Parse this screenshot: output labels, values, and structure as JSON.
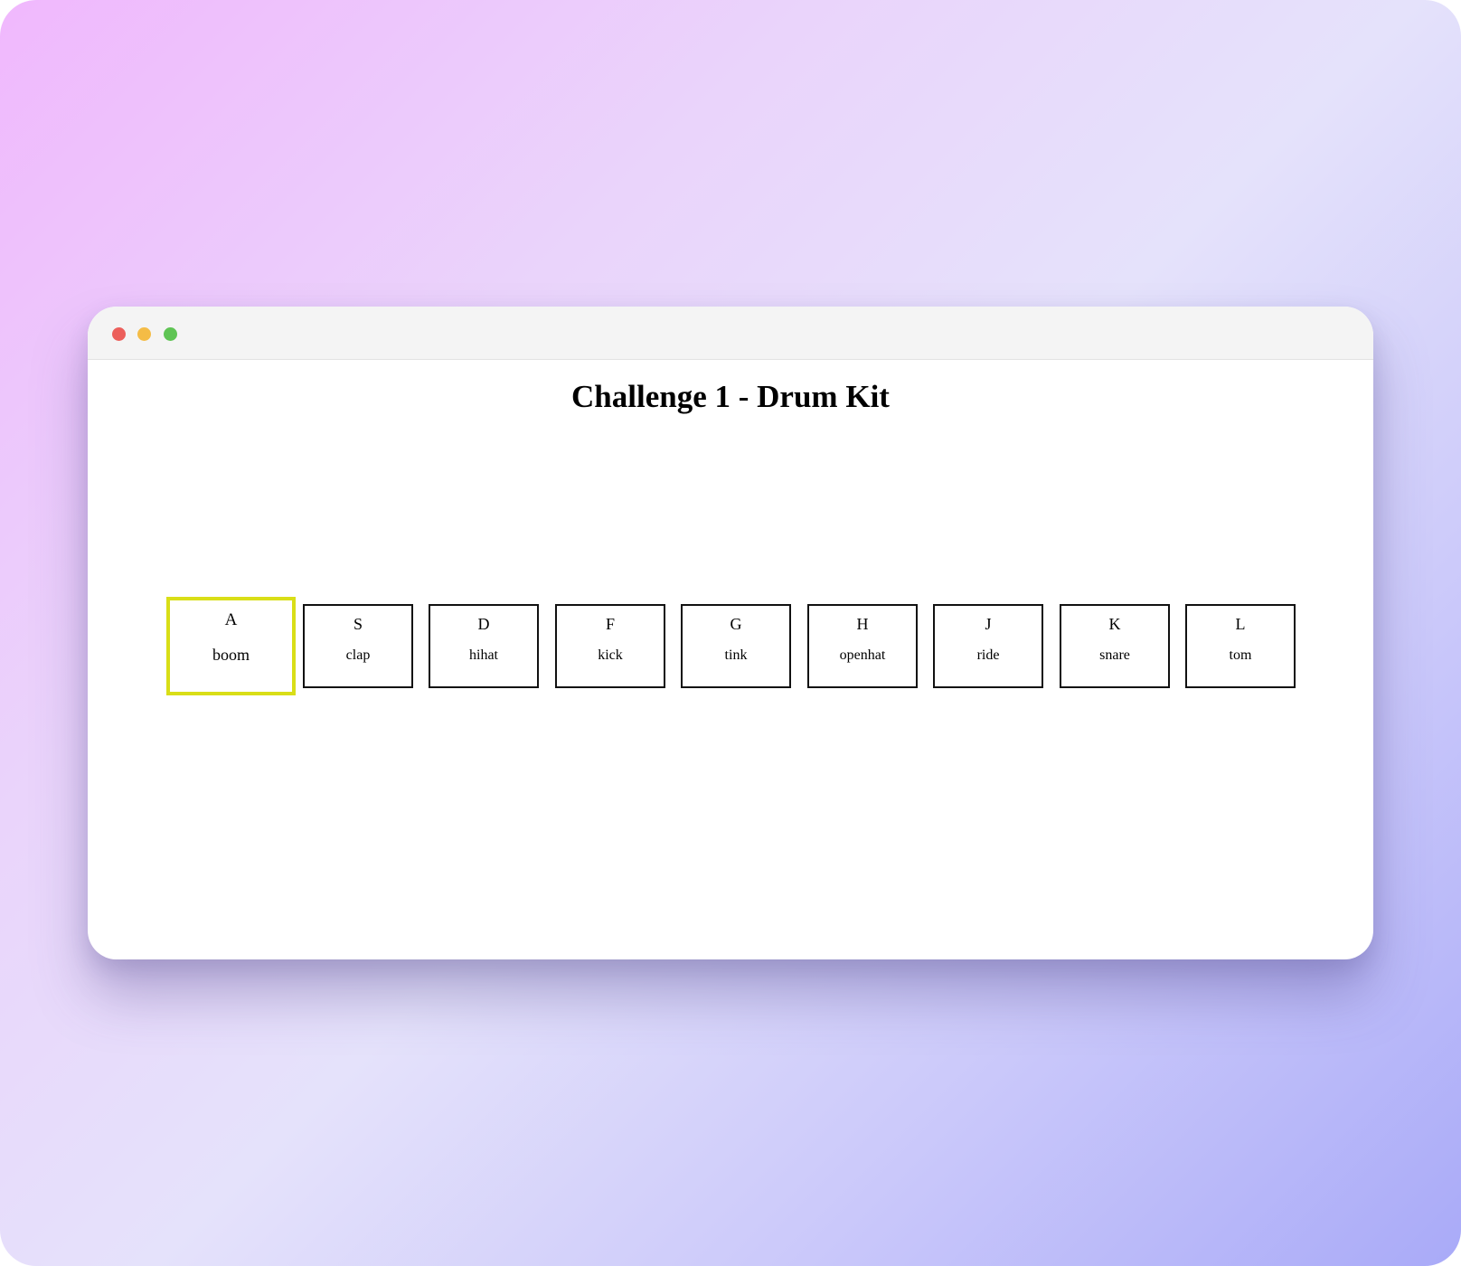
{
  "page": {
    "title": "Challenge 1 - Drum Kit"
  },
  "window": {
    "controls": [
      "close",
      "minimize",
      "maximize"
    ],
    "colors": {
      "close": "#ec5f5b",
      "minimize": "#f4bc46",
      "maximize": "#5fc454"
    }
  },
  "keys": [
    {
      "key": "A",
      "sound": "boom",
      "playing": true
    },
    {
      "key": "S",
      "sound": "clap",
      "playing": false
    },
    {
      "key": "D",
      "sound": "hihat",
      "playing": false
    },
    {
      "key": "F",
      "sound": "kick",
      "playing": false
    },
    {
      "key": "G",
      "sound": "tink",
      "playing": false
    },
    {
      "key": "H",
      "sound": "openhat",
      "playing": false
    },
    {
      "key": "J",
      "sound": "ride",
      "playing": false
    },
    {
      "key": "K",
      "sound": "snare",
      "playing": false
    },
    {
      "key": "L",
      "sound": "tom",
      "playing": false
    }
  ],
  "colors": {
    "playing_border": "#d9de17",
    "key_border": "#111111"
  }
}
